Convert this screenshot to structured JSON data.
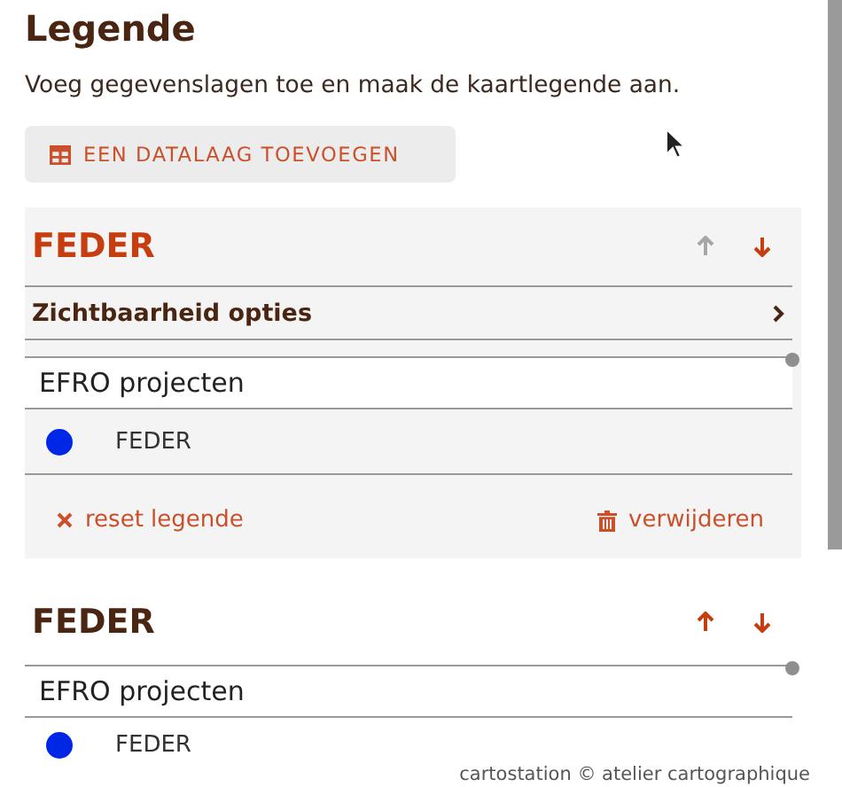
{
  "title": "Legende",
  "description": "Voeg gegevenslagen toe en maak de kaartlegende aan.",
  "add_button": "EEN DATALAAG TOEVOEGEN",
  "layers": [
    {
      "title": "FEDER",
      "active": true,
      "can_move_up": false,
      "can_move_down": true,
      "options": "Zichtbaarheid opties",
      "name": "EFRO projecten",
      "items": [
        {
          "label": "FEDER",
          "color": "#0026e6"
        }
      ],
      "reset": "reset legende",
      "remove": "verwijderen"
    },
    {
      "title": "FEDER",
      "active": false,
      "can_move_up": true,
      "can_move_down": true,
      "name": "EFRO projecten",
      "items": [
        {
          "label": "FEDER",
          "color": "#0026e6"
        }
      ]
    }
  ],
  "footer": "cartostation © atelier cartographique"
}
